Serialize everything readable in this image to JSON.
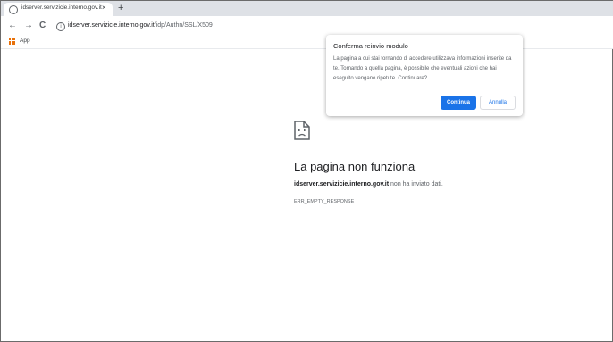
{
  "browser": {
    "tab": {
      "title": "idserver.servizicie.interno.gov.it",
      "close": "×"
    },
    "new_tab": "+",
    "nav": {
      "back": "←",
      "forward": "→",
      "reload": "C"
    },
    "address_bar": {
      "info": "i",
      "host": "idserver.servizicie.interno.gov.it",
      "path": "/idp/Authn/SSL/X509"
    },
    "bookmarks": {
      "apps_label": "App"
    }
  },
  "error_page": {
    "title": "La pagina non funziona",
    "host": "idserver.servizicie.interno.gov.it",
    "message_suffix": " non ha inviato dati.",
    "code": "ERR_EMPTY_RESPONSE"
  },
  "dialog": {
    "title": "Conferma reinvio modulo",
    "message": "La pagina a cui stai tornando di accedere utilizzava informazioni inserite da te. Tornando a quella pagina, è possibile che eventuali azioni che hai eseguito vengano ripetute. Continuare?",
    "confirm_label": "Continua",
    "cancel_label": "Annulla"
  },
  "colors": {
    "accent": "#1a73e8",
    "tabstrip": "#dee1e6"
  },
  "icons": [
    "globe-icon",
    "close-icon",
    "plus-icon",
    "back-icon",
    "forward-icon",
    "reload-icon",
    "info-icon",
    "apps-icon",
    "sad-page-icon"
  ]
}
